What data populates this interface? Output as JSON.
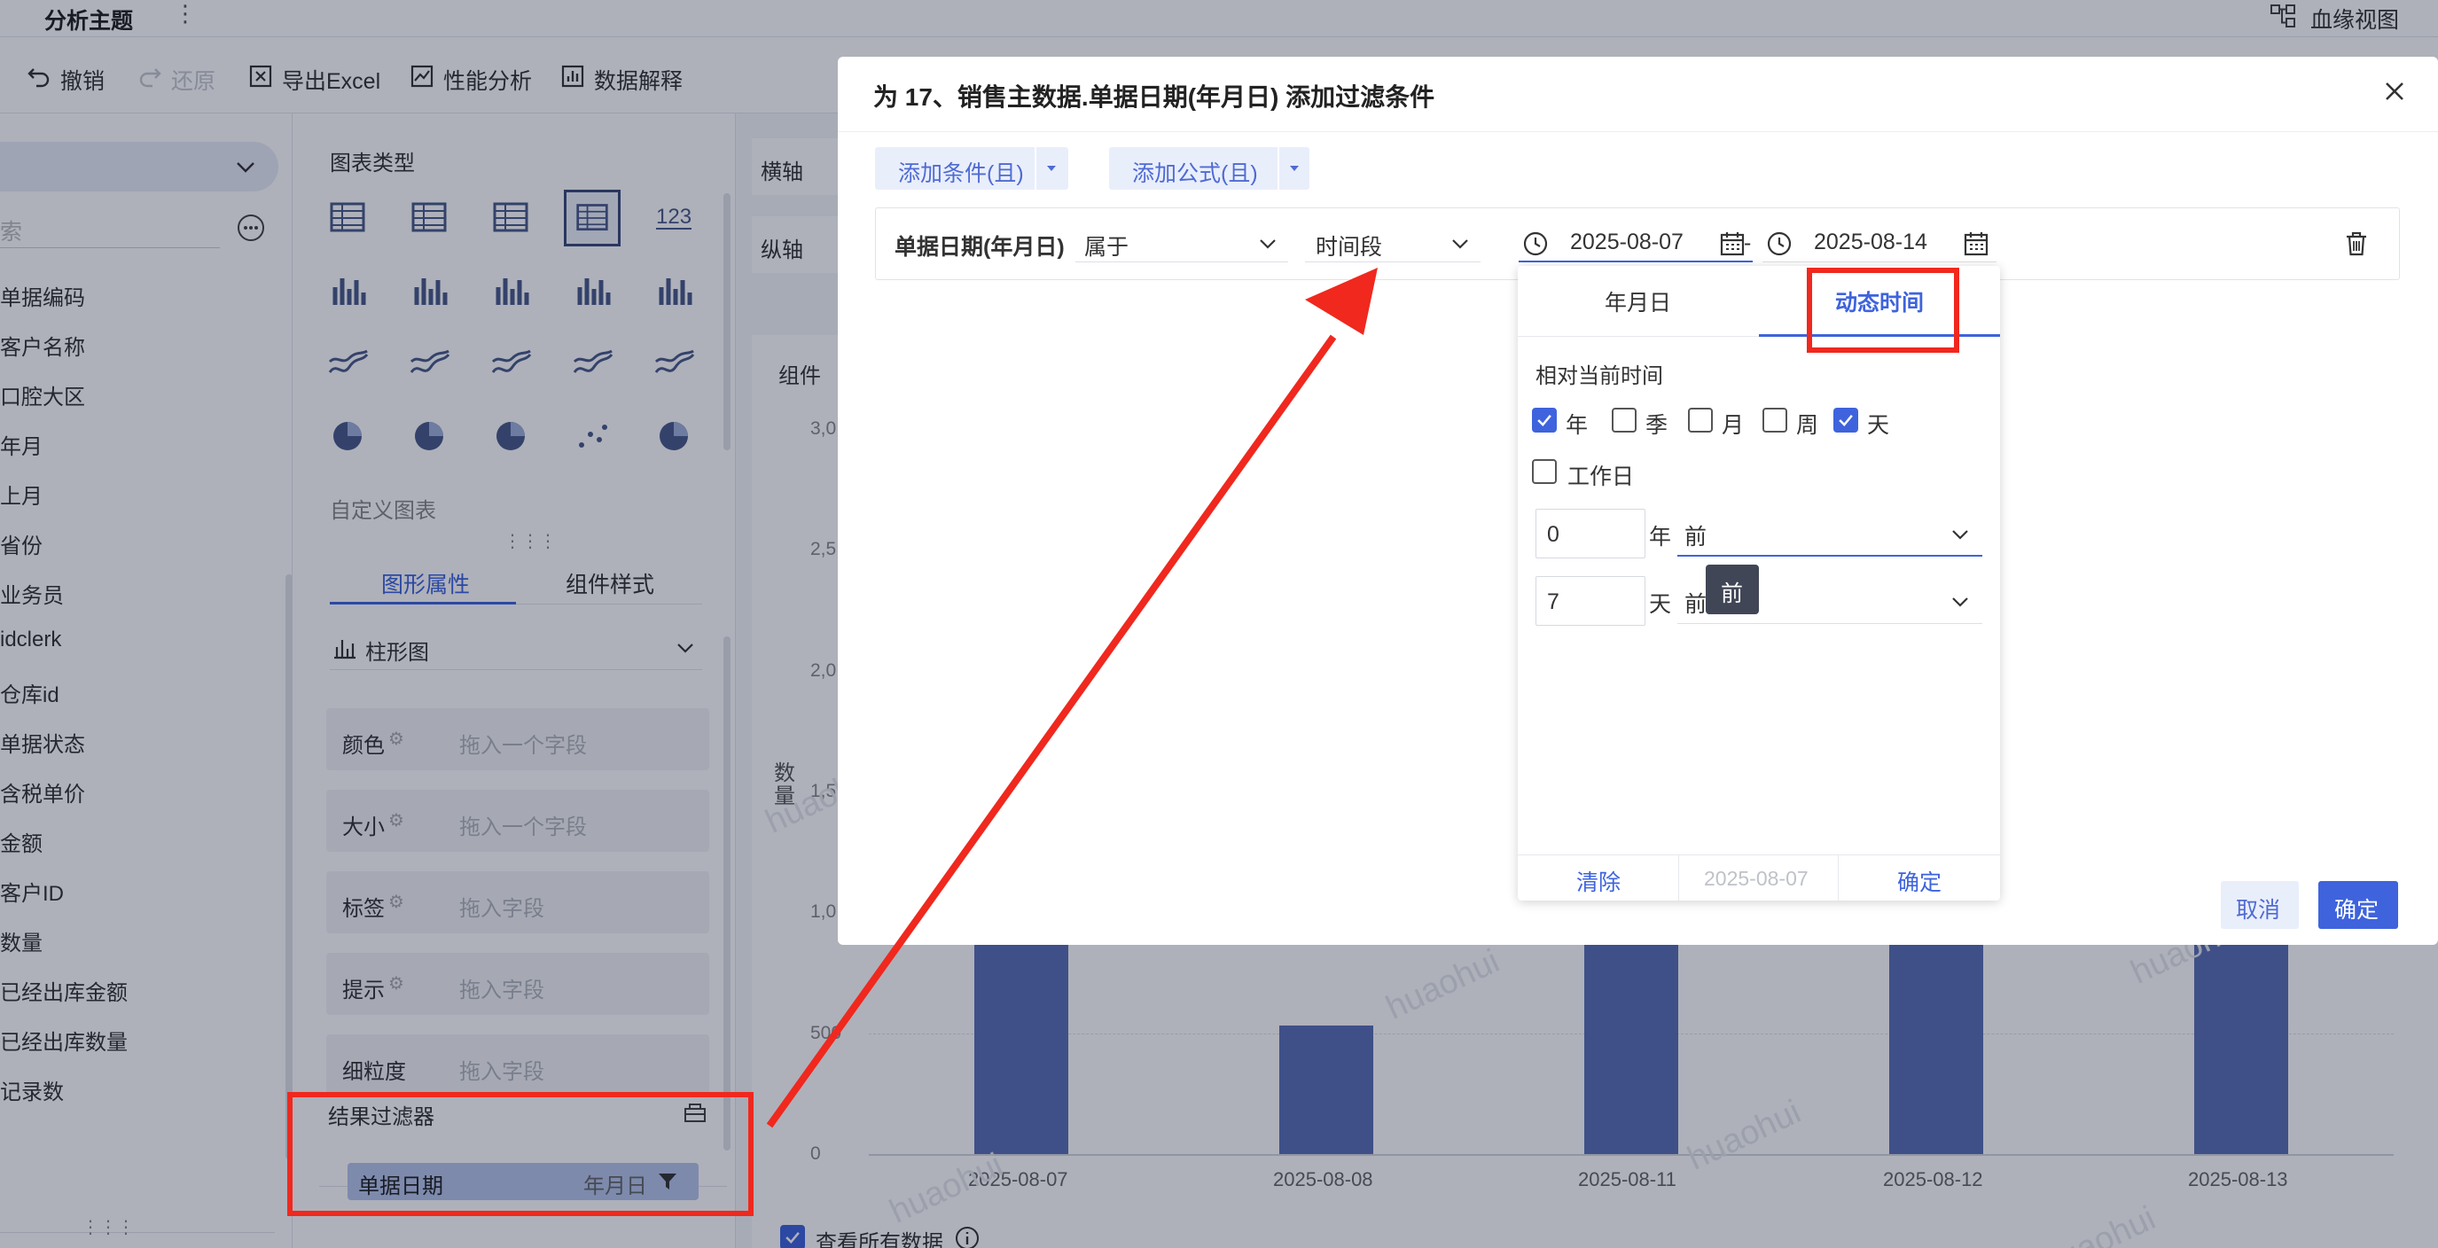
{
  "topbar": {
    "title": "分析主题",
    "lineage_view": "血缘视图"
  },
  "toolbar": {
    "undo": "撤销",
    "redo": "还原",
    "export_excel": "导出Excel",
    "perf": "性能分析",
    "data_explain": "数据解释"
  },
  "left_panel": {
    "search_placeholder": "索",
    "fields": [
      "单据编码",
      "客户名称",
      "口腔大区",
      "年月",
      "上月",
      "省份",
      "业务员",
      "idclerk",
      "仓库id",
      "单据状态",
      "含税单价",
      "金额",
      "客户ID",
      "数量",
      "已经出库金额",
      "已经出库数量",
      "记录数"
    ]
  },
  "mid_panel": {
    "chart_type_title": "图表类型",
    "custom_chart": "自定义图表",
    "tabs": [
      "图形属性",
      "组件样式"
    ],
    "bar_chart": "柱形图",
    "props": [
      {
        "key": "颜色",
        "hint": "拖入一个字段"
      },
      {
        "key": "大小",
        "hint": "拖入一个字段"
      },
      {
        "key": "标签",
        "hint": "拖入字段"
      },
      {
        "key": "提示",
        "hint": "拖入字段"
      },
      {
        "key": "细粒度",
        "hint": "拖入字段"
      }
    ],
    "result_filter": {
      "title": "结果过滤器",
      "chip_field": "单据日期",
      "chip_granularity": "年月日"
    }
  },
  "right_area": {
    "x_axis": "横轴",
    "y_axis": "纵轴",
    "component": "组件",
    "y_title": "数量",
    "watermark": "huaohui",
    "view_all": "查看所有数据"
  },
  "chart_data": {
    "type": "bar",
    "categories": [
      "2025-08-07",
      "2025-08-08",
      "2025-08-11",
      "2025-08-12",
      "2025-08-13"
    ],
    "values": [
      1200,
      530,
      1200,
      1200,
      1200
    ],
    "ylabel": "数量",
    "yticks": [
      "0",
      "500",
      "1,0",
      "1,5",
      "2,0",
      "2,5",
      "3,0"
    ],
    "ylim": [
      0,
      3000
    ]
  },
  "dialog": {
    "title": "为 17、销售主数据.单据日期(年月日) 添加过滤条件",
    "add_condition": "添加条件(且)",
    "add_formula": "添加公式(且)",
    "cond_field": "单据日期(年月日)",
    "cond_op": "属于",
    "cond_type": "时间段",
    "start_date": "2025-08-07",
    "end_date": "2025-08-14",
    "sep": "-",
    "cancel": "取消",
    "ok": "确定"
  },
  "popover": {
    "tabs": [
      "年月日",
      "动态时间"
    ],
    "relative_title": "相对当前时间",
    "checks": [
      {
        "label": "年",
        "checked": true
      },
      {
        "label": "季",
        "checked": false
      },
      {
        "label": "月",
        "checked": false
      },
      {
        "label": "周",
        "checked": false
      },
      {
        "label": "天",
        "checked": true
      }
    ],
    "workday": "工作日",
    "row1": {
      "value": "0",
      "unit": "年",
      "dir": "前"
    },
    "row2": {
      "value": "7",
      "unit": "天",
      "dir": "前"
    },
    "tooltip": "前",
    "footer": {
      "clear": "清除",
      "date": "2025-08-07",
      "ok": "确定"
    }
  },
  "colors": {
    "accent": "#3e63dd",
    "bar": "#5a6fb5",
    "highlight": "#f0281e"
  }
}
